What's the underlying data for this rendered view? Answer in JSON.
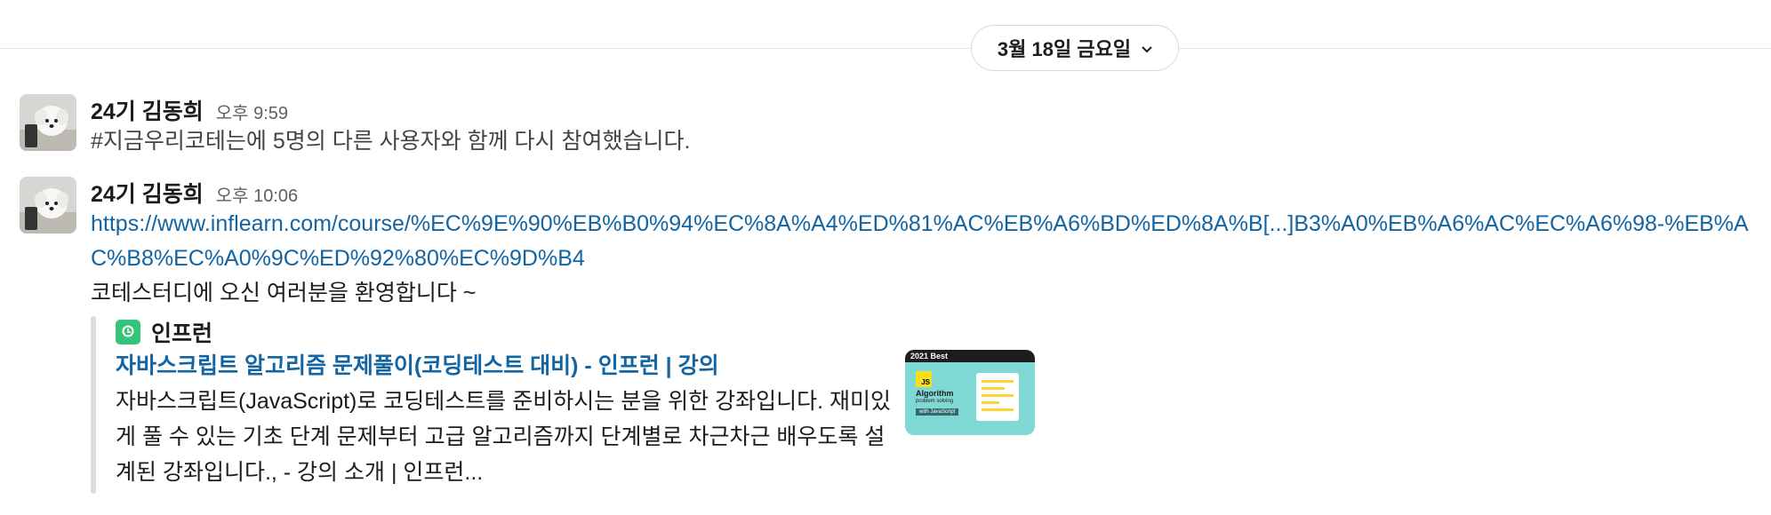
{
  "date_divider": {
    "label": "3월 18일 금요일",
    "chevron_icon": "chevron-down-icon"
  },
  "messages": [
    {
      "author": "24기 김동희",
      "timestamp": "오후 9:59",
      "text": "#지금우리코테는에 5명의 다른 사용자와 함께 다시 참여했습니다."
    },
    {
      "author": "24기 김동희",
      "timestamp": "오후 10:06",
      "link": "https://www.inflearn.com/course/%EC%9E%90%EB%B0%94%EC%8A%A4%ED%81%AC%EB%A6%BD%ED%8A%B[...]B3%A0%EB%A6%AC%EC%A6%98-%EB%AC%B8%EC%A0%9C%ED%92%80%EC%9D%B4",
      "text": "코테스터디에 오신 여러분을 환영합니다 ~",
      "unfurl": {
        "service_name": "인프런",
        "service_icon": "inflearn-logo-icon",
        "title": "자바스크립트 알고리즘 문제풀이(코딩테스트 대비) - 인프런 | 강의",
        "description": "자바스크립트(JavaScript)로 코딩테스트를 준비하시는 분을 위한 강좌입니다. 재미있게 풀 수 있는 기초 단계 문제부터 고급 알고리즘까지 단계별로 차근차근 배우도록 설계된 강좌입니다., - 강의 소개 | 인프런...",
        "thumbnail": {
          "badge": "2021 Best",
          "js_label": "JS",
          "heading": "Algorithm",
          "subheading": "problem solving",
          "tag": "with JavaScript"
        }
      }
    }
  ],
  "colors": {
    "link": "#1264a3",
    "text": "#1d1c1d",
    "muted": "#616061",
    "divider": "#e2e2e2",
    "quote_bar": "#dddddd",
    "inflearn_green": "#35c47c"
  }
}
